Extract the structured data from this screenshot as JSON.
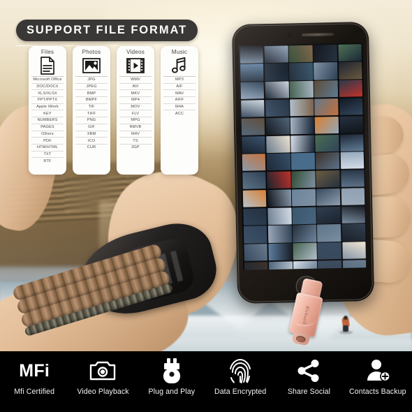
{
  "header": {
    "title": "SUPPORT FILE FORMAT",
    "pill_color": "#3a3836",
    "text_color": "#ffffff"
  },
  "format_cards": [
    {
      "title": "Files",
      "icon": "document-icon",
      "formats": [
        "Microsoft Office",
        "DOC/DOCX",
        "XLS/XLSX",
        "PPT/PPTX",
        "Apple iWork",
        "KEY",
        "NUMBERS",
        "PAGES",
        "Others",
        "PDF",
        "HTM/HTML",
        "TXT",
        "RTF"
      ]
    },
    {
      "title": "Photos",
      "icon": "photo-icon",
      "formats": [
        "JPG",
        "JPEG",
        "BMP",
        "BMPF",
        "TIF",
        "TIFF",
        "PNG",
        "GIF",
        "XBM",
        "ICO",
        "CUR"
      ]
    },
    {
      "title": "Videos",
      "icon": "film-icon",
      "formats": [
        "WMV",
        "AVI",
        "MKV",
        "MP4",
        "MOV",
        "FLV",
        "MPG",
        "RMVB",
        "M4V",
        "TS",
        "3GP"
      ]
    },
    {
      "title": "Music",
      "icon": "music-note-icon",
      "formats": [
        "MP3",
        "AIF",
        "WAV",
        "AIFF",
        "M4A",
        "ACC"
      ]
    }
  ],
  "product": {
    "brand": "Richwell",
    "device_color": "#f1b7a5",
    "device_type": "otg-flash-drive"
  },
  "features": [
    {
      "icon": "mfi-logo-icon",
      "glyph": "MFi",
      "label": "Mfi Certified"
    },
    {
      "icon": "camera-icon",
      "glyph": "",
      "label": "Video Playback"
    },
    {
      "icon": "usb-drive-icon",
      "glyph": "",
      "label": "Plug and Play"
    },
    {
      "icon": "fingerprint-icon",
      "glyph": "",
      "label": "Data Encrypted"
    },
    {
      "icon": "share-network-icon",
      "glyph": "",
      "label": "Share Social"
    },
    {
      "icon": "contact-add-icon",
      "glyph": "",
      "label": "Contacts Backup"
    }
  ],
  "feature_bar": {
    "background": "#000000",
    "text_color": "#f2f2f2"
  },
  "photo_grid": {
    "columns": 5,
    "rows": 13,
    "thumbnail_colors": [
      "#6d7f93",
      "#1c2230",
      "#2e4a31",
      "#0d1016",
      "#4a6e52",
      "#5b7da0",
      "#101822",
      "#37556b",
      "#2a3e52",
      "#6b5a3f",
      "#8fa3b8",
      "#1a2433",
      "#3f5d4a",
      "#5c4a36",
      "#2b3a4c",
      "#cfd8e2",
      "#223041",
      "#7a6248",
      "#c4703a",
      "#31455c",
      "#4e6379",
      "#0e1219",
      "#a8b6c4",
      "#d88030",
      "#24303e",
      "#36506a",
      "#f0e4d2",
      "#132033",
      "#2c4056",
      "#5d7a93",
      "#8899ab",
      "#1b2836",
      "#476b8a",
      "#3a2f28",
      "#93a7bb",
      "#2d3f52",
      "#c03028",
      "#7e8fa2",
      "#1f2b38",
      "#586e86",
      "#b6c3d0",
      "#0c1017",
      "#6a8299",
      "#33465a",
      "#8c9cae",
      "#223142",
      "#d4dce6",
      "#44607b",
      "#121a26",
      "#74889c",
      "#3c5067",
      "#9aa9ba",
      "#1e2a38",
      "#5a7186",
      "#2a3848",
      "#66798d",
      "#0f161f",
      "#b0bdc9",
      "#2f4154",
      "#7f91a4",
      "#1a242f",
      "#4b6076",
      "#d9e1e9",
      "#36485c",
      "#62768a"
    ]
  }
}
